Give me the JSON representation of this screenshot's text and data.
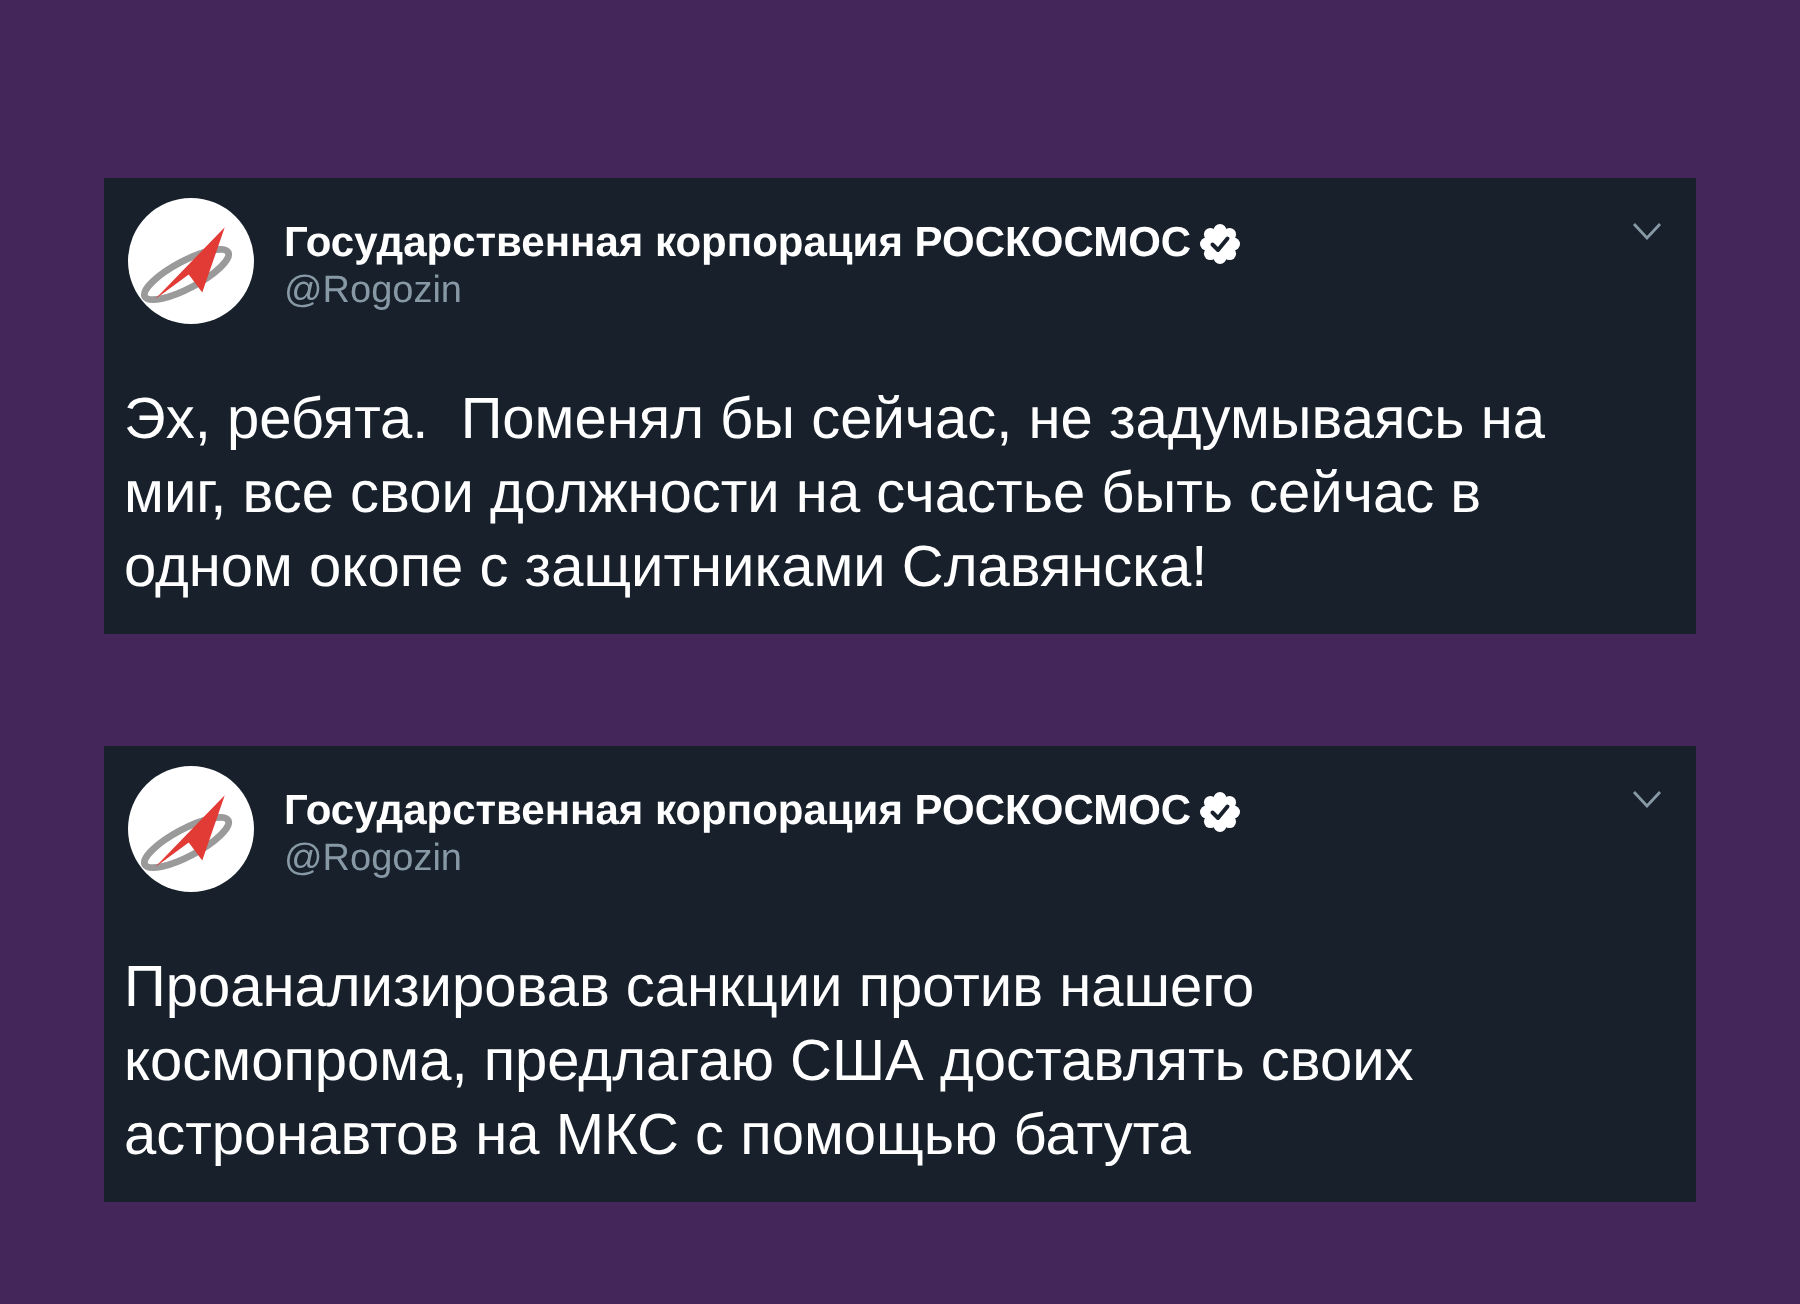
{
  "tweets": [
    {
      "author": {
        "name": "Государственная корпорация РОСКОСМОС",
        "verified": true,
        "handle": "@Rogozin"
      },
      "text": "Эх, ребята.  Поменял бы сейчас, не задумываясь на миг, все свои должности на счастье быть сейчас в одном окопе с защитниками Славянска!"
    },
    {
      "author": {
        "name": "Государственная корпорация РОСКОСМОС",
        "verified": true,
        "handle": "@Rogozin"
      },
      "text": "Проанализировав санкции против нашего космопрома, предлагаю США доставлять своих астронавтов на МКС с помощью батута"
    }
  ]
}
